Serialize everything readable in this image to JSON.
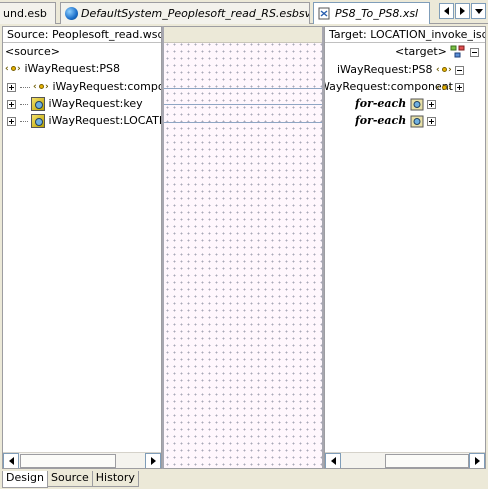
{
  "tabs": [
    {
      "label": "und.esb",
      "active": false,
      "icon": "none"
    },
    {
      "label": "DefaultSystem_Peoplesoft_read_RS.esbsvc",
      "active": false,
      "icon": "globe-icon"
    },
    {
      "label": "PS8_To_PS8.xsl",
      "active": true,
      "icon": "xsl-file-icon"
    }
  ],
  "source": {
    "header": "Source: Peoplesoft_read.wsdl",
    "root": "<source>",
    "element": "iWayRequest:PS8",
    "children": [
      "iWayRequest:component",
      "iWayRequest:key",
      "iWayRequest:LOCATION"
    ]
  },
  "target": {
    "header": "Target: LOCATION_invoke_isds",
    "root": "<target>",
    "element": "iWayRequest:PS8",
    "children": [
      {
        "label": "iWayRequest:component",
        "kind": "element"
      },
      {
        "label": "for-each",
        "kind": "for-each"
      },
      {
        "label": "for-each",
        "kind": "for-each"
      }
    ]
  },
  "bottom_tabs": [
    "Design",
    "Source",
    "History"
  ],
  "colors": {
    "background": "#ece9d8",
    "mapping_canvas": "#fff7fd",
    "link": "#8fa6c4"
  }
}
